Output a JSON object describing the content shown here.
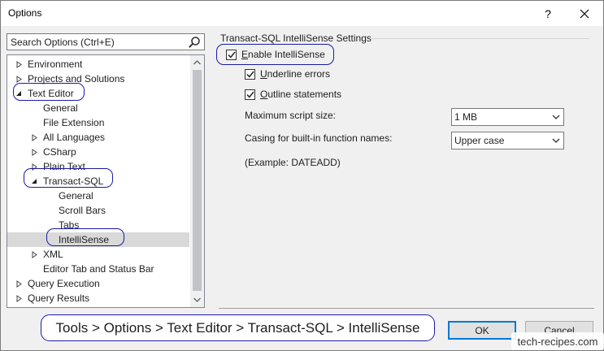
{
  "window": {
    "title": "Options",
    "help_label": "?",
    "close_label": "✕"
  },
  "search": {
    "placeholder": "Search Options (Ctrl+E)"
  },
  "tree": {
    "items": [
      {
        "label": "Environment",
        "expander": "collapsed"
      },
      {
        "label": "Projects and Solutions",
        "expander": "collapsed"
      },
      {
        "label": "Text Editor",
        "expander": "expanded"
      },
      {
        "label": "General",
        "expander": "none"
      },
      {
        "label": "File Extension",
        "expander": "none"
      },
      {
        "label": "All Languages",
        "expander": "collapsed"
      },
      {
        "label": "CSharp",
        "expander": "collapsed"
      },
      {
        "label": "Plain Text",
        "expander": "collapsed"
      },
      {
        "label": "Transact-SQL",
        "expander": "expanded"
      },
      {
        "label": "General",
        "expander": "none"
      },
      {
        "label": "Scroll Bars",
        "expander": "none"
      },
      {
        "label": "Tabs",
        "expander": "none"
      },
      {
        "label": "IntelliSense",
        "expander": "none",
        "selected": true
      },
      {
        "label": "XML",
        "expander": "collapsed"
      },
      {
        "label": "Editor Tab and Status Bar",
        "expander": "none"
      },
      {
        "label": "Query Execution",
        "expander": "collapsed"
      },
      {
        "label": "Query Results",
        "expander": "collapsed"
      }
    ]
  },
  "settings": {
    "group_title": "Transact-SQL IntelliSense Settings",
    "enable_intellisense": {
      "label": "Enable IntelliSense",
      "checked": true
    },
    "underline_errors": {
      "label": "Underline errors",
      "checked": true
    },
    "outline_statements": {
      "label": "Outline statements",
      "checked": true
    },
    "max_script_size": {
      "label": "Maximum script size:",
      "value": "1 MB"
    },
    "casing": {
      "label": "Casing for built-in function names:",
      "value": "Upper case"
    },
    "example": "(Example: DATEADD)"
  },
  "buttons": {
    "ok": "OK",
    "cancel": "Cancel"
  },
  "annotation": {
    "path": "Tools > Options > Text Editor > Transact-SQL > IntelliSense"
  },
  "watermark": "tech-recipes.com",
  "colors": {
    "selection": "#d9d9d9",
    "highlight_outline": "#1a1aa8",
    "default_button_border": "#0078d7"
  }
}
